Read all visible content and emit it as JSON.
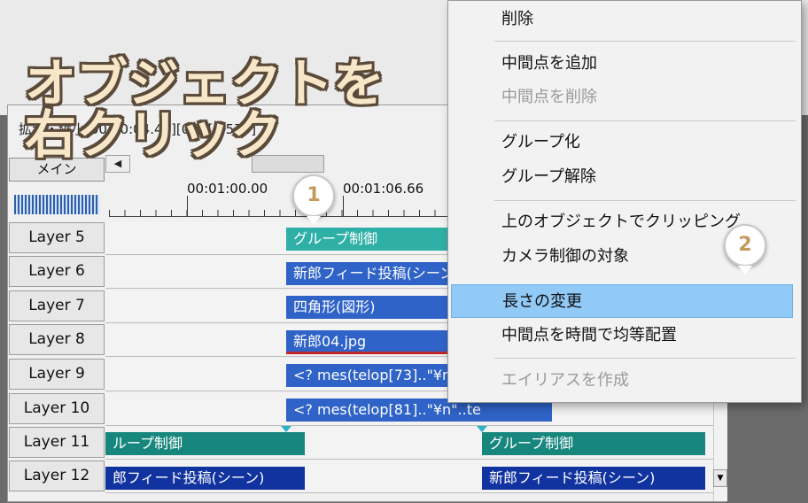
{
  "window": {
    "title": "拡大・縮小[00:00:04.40][0.3][3.570]"
  },
  "sidebar": {
    "main_tab": "メイン",
    "layers": [
      "Layer 5",
      "Layer 6",
      "Layer 7",
      "Layer 8",
      "Layer 9",
      "Layer 10",
      "Layer 11",
      "Layer 12"
    ]
  },
  "timeline": {
    "scroll_left_arrow": "◀",
    "times": [
      "00:01:00.00",
      "00:01:06.66"
    ],
    "clips": [
      {
        "label": "グループ制御",
        "color": "#2fb0a6"
      },
      {
        "label": "新郎フィード投稿(シーン",
        "color": "#2f63c7"
      },
      {
        "label": "四角形(図形)",
        "color": "#2f63c7"
      },
      {
        "label": "新郎04.jpg",
        "color": "#2f63c7"
      },
      {
        "label": "<? mes(telop[73]..\"¥n\"..t",
        "color": "#2f63c7"
      },
      {
        "label": "<? mes(telop[81]..\"¥n\"..te",
        "color": "#2f63c7"
      },
      {
        "label": "ループ制御",
        "color": "#17877e"
      },
      {
        "label": "グループ制御",
        "color": "#17877e"
      },
      {
        "label": "郎フィード投稿(シーン)",
        "color": "#1133a0"
      },
      {
        "label": "新郎フィード投稿(シーン)",
        "color": "#1133a0"
      }
    ],
    "scroll_down_arrow": "▼"
  },
  "context_menu": {
    "items": [
      {
        "label": "削除",
        "disabled": false
      },
      {
        "label": "中間点を追加",
        "disabled": false
      },
      {
        "label": "中間点を削除",
        "disabled": true
      },
      {
        "label": "グループ化",
        "disabled": false
      },
      {
        "label": "グループ解除",
        "disabled": false
      },
      {
        "label": "上のオブジェクトでクリッピング",
        "disabled": false
      },
      {
        "label": "カメラ制御の対象",
        "disabled": false
      },
      {
        "label": "長さの変更",
        "disabled": false,
        "highlighted": true
      },
      {
        "label": "中間点を時間で均等配置",
        "disabled": false
      },
      {
        "label": "エイリアスを作成",
        "disabled": true
      }
    ]
  },
  "overlay": {
    "line1": "オブジェクトを",
    "line2": "右クリック"
  },
  "badges": [
    "1",
    "2"
  ],
  "colors": {
    "highlight": "#91c9f7",
    "overlay_text": "#f7e7c8",
    "badge_number": "#c49a5c"
  }
}
